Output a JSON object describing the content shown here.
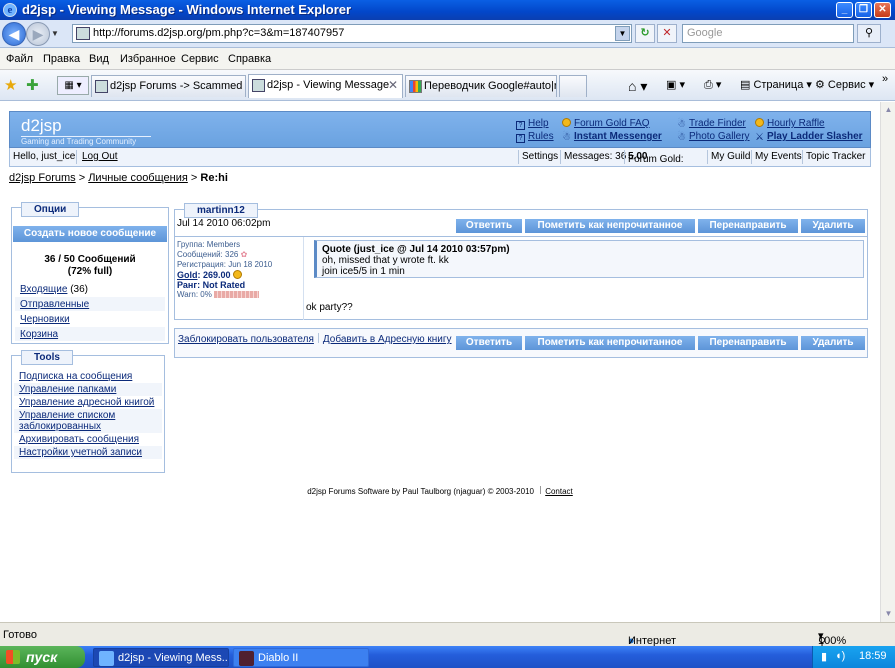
{
  "window": {
    "title": "d2jsp - Viewing Message - Windows Internet Explorer",
    "min": "_",
    "max": "❐",
    "close": "✕"
  },
  "addressbar": {
    "url": "http://forums.d2jsp.org/pm.php?c=3&m=187407957",
    "search_placeholder": "Google"
  },
  "menu": [
    "Файл",
    "Правка",
    "Вид",
    "Избранное",
    "Сервис",
    "Справка"
  ],
  "tabs": [
    {
      "label": "d2jsp Forums -> Scammed B..."
    },
    {
      "label": "d2jsp - Viewing Message"
    },
    {
      "label": "Переводчик Google#auto|r..."
    }
  ],
  "ie_tools": {
    "page": "Страница",
    "service": "Сервис"
  },
  "site": {
    "logo": "d2jsp",
    "tagline": "Gaming and Trading Community",
    "links": {
      "help": "Help",
      "rules": "Rules",
      "forum_gold_faq": "Forum Gold FAQ",
      "instant_messenger": "Instant Messenger",
      "trade_finder": "Trade Finder",
      "photo_gallery": "Photo Gallery",
      "hourly_raffle": "Hourly Raffle",
      "play_ladder_slasher": "Play Ladder Slasher"
    }
  },
  "userbar": {
    "hello": "Hello, just_ice",
    "logout": "Log Out",
    "settings": "Settings",
    "messages": "Messages: 36",
    "forum_gold_label": "Forum Gold:",
    "forum_gold_value": "5.00",
    "my_guild": "My Guild",
    "my_events": "My Events",
    "topic_tracker": "Topic Tracker"
  },
  "breadcrumb": {
    "root": "d2jsp Forums",
    "sep": ">",
    "pm": "Личные сообщения",
    "current": "Re:hi"
  },
  "options": {
    "title": "Опции",
    "create": "Создать новое сообщение",
    "count": "36 / 50 Сообщений",
    "percent": "(72% full)",
    "inbox": "Входящие",
    "inbox_count": "(36)",
    "sent": "Отправленные",
    "drafts": "Черновики",
    "trash": "Корзина"
  },
  "tools": {
    "title": "Tools",
    "items": [
      "Подписка на сообщения",
      "Управление папками",
      "Управление адресной книгой",
      "Управление списком заблокированных",
      "Архивировать сообщения",
      "Настройки учетной записи"
    ]
  },
  "message": {
    "sender": "martinn12",
    "date": "Jul 14 2010 06:02pm",
    "buttons": {
      "reply": "Ответить",
      "mark_unread": "Пометить как непрочитанное",
      "forward": "Перенаправить",
      "delete": "Удалить"
    },
    "profile": {
      "group": "Группа: Members",
      "posts": "Сообщений: 326",
      "registered": "Регистрация: Jun 18 2010",
      "gold_label": "Gold",
      "gold_value": "269.00",
      "rank": "Ранг: Not Rated",
      "warn": "Warn: 0%"
    },
    "quote_header": "Quote (just_ice @ Jul 14 2010 03:57pm)",
    "quote_lines": [
      "oh, missed that y wrote ft. kk",
      "join ice5/5 in 1 min"
    ],
    "body": "ok party??"
  },
  "bottom_actions": {
    "block_user": "Заблокировать пользователя",
    "add_address": "Добавить в Адресную книгу"
  },
  "footer": {
    "text": "d2jsp Forums Software by Paul Taulborg (njaguar) © 2003-2010",
    "contact": "Contact"
  },
  "statusbar": {
    "status": "Готово",
    "zone": "Интернет",
    "zoom": "100%"
  },
  "taskbar": {
    "start": "пуск",
    "tasks": [
      "d2jsp - Viewing Mess...",
      "Diablo II"
    ],
    "clock": "18:59"
  },
  "colors": {
    "accent": "#6aa2e0",
    "link": "#0b2a7a",
    "gold": "#f3b81a"
  }
}
